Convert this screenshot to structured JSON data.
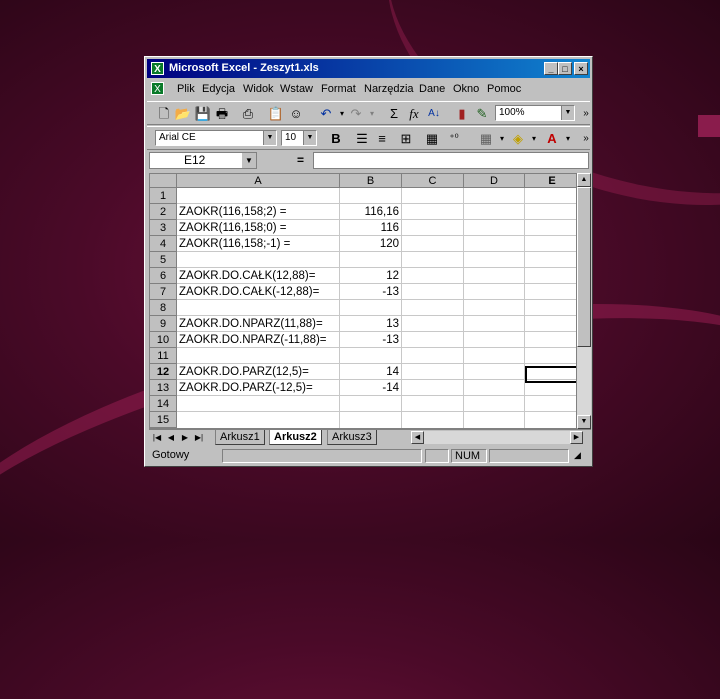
{
  "window": {
    "title": "Microsoft Excel - Zeszyt1.xls",
    "app_icon": "excel-icon"
  },
  "menu": [
    "Plik",
    "Edycja",
    "Widok",
    "Wstaw",
    "Format",
    "Narzędzia",
    "Dane",
    "Okno",
    "Pomoc"
  ],
  "toolbar": {
    "zoom": "100%",
    "font": "Arial CE",
    "font_size": "10"
  },
  "formula_bar": {
    "name_box": "E12",
    "equals": "="
  },
  "columns": [
    "A",
    "B",
    "C",
    "D",
    "E"
  ],
  "rows": [
    {
      "num": "1",
      "a": "",
      "b": ""
    },
    {
      "num": "2",
      "a": "ZAOKR(116,158;2) =",
      "b": "116,16"
    },
    {
      "num": "3",
      "a": "ZAOKR(116,158;0) =",
      "b": "116"
    },
    {
      "num": "4",
      "a": "ZAOKR(116,158;-1) =",
      "b": "120"
    },
    {
      "num": "5",
      "a": "",
      "b": ""
    },
    {
      "num": "6",
      "a": "ZAOKR.DO.CAŁK(12,88)=",
      "b": "12"
    },
    {
      "num": "7",
      "a": "ZAOKR.DO.CAŁK(-12,88)=",
      "b": "-13"
    },
    {
      "num": "8",
      "a": "",
      "b": ""
    },
    {
      "num": "9",
      "a": "ZAOKR.DO.NPARZ(11,88)=",
      "b": "13"
    },
    {
      "num": "10",
      "a": "ZAOKR.DO.NPARZ(-11,88)=",
      "b": "-13"
    },
    {
      "num": "11",
      "a": "",
      "b": ""
    },
    {
      "num": "12",
      "a": "ZAOKR.DO.PARZ(12,5)=",
      "b": "14"
    },
    {
      "num": "13",
      "a": "ZAOKR.DO.PARZ(-12,5)=",
      "b": "-14"
    },
    {
      "num": "14",
      "a": "",
      "b": ""
    },
    {
      "num": "15",
      "a": "",
      "b": ""
    }
  ],
  "sheets": [
    "Arkusz1",
    "Arkusz2",
    "Arkusz3"
  ],
  "active_sheet": "Arkusz2",
  "status": {
    "ready": "Gotowy",
    "num": "NUM"
  }
}
